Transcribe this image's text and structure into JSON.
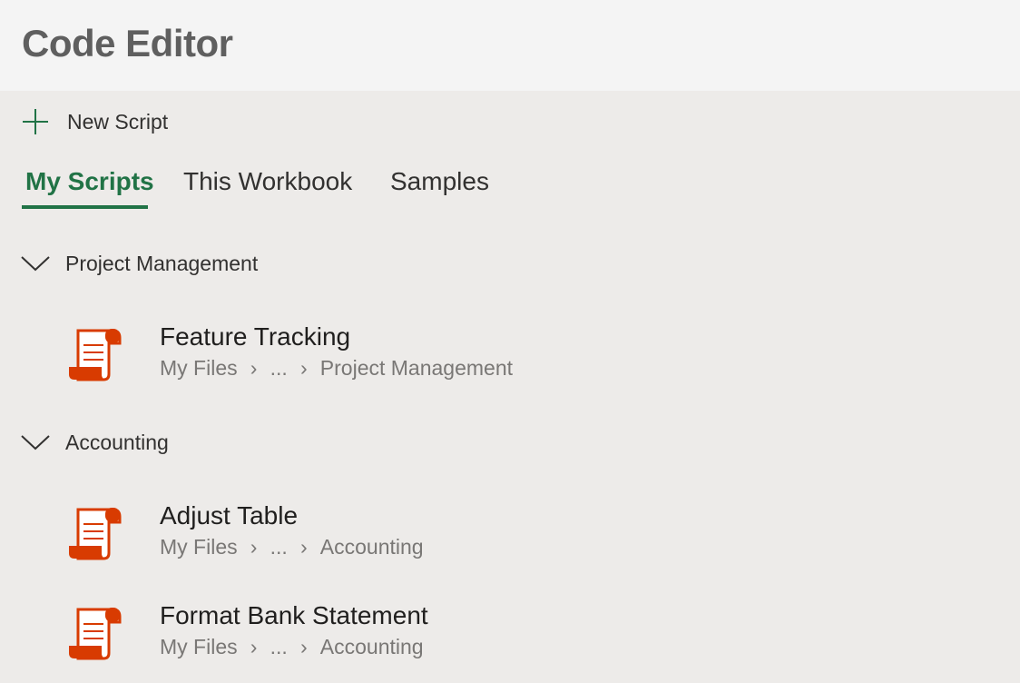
{
  "header": {
    "title": "Code Editor"
  },
  "actions": {
    "new_script_label": "New Script",
    "new_script_icon": "plus-icon"
  },
  "tabs": [
    {
      "label": "My Scripts",
      "active": true
    },
    {
      "label": "This Workbook",
      "active": false
    },
    {
      "label": "Samples",
      "active": false
    }
  ],
  "groups": [
    {
      "label": "Project Management",
      "expanded": true,
      "scripts": [
        {
          "name": "Feature Tracking",
          "path": [
            "My Files",
            "...",
            "Project Management"
          ]
        }
      ]
    },
    {
      "label": "Accounting",
      "expanded": true,
      "scripts": [
        {
          "name": "Adjust Table",
          "path": [
            "My Files",
            "...",
            "Accounting"
          ]
        },
        {
          "name": "Format Bank Statement",
          "path": [
            "My Files",
            "...",
            "Accounting"
          ]
        }
      ]
    }
  ],
  "colors": {
    "accent": "#217346",
    "script_icon": "#d83b01",
    "header_bg": "#f4f4f4",
    "body_bg": "#edebe9"
  },
  "icons": {
    "script": "script-file-icon",
    "expand": "chevron-down-icon",
    "breadcrumb_separator": "chevron-right-icon"
  }
}
